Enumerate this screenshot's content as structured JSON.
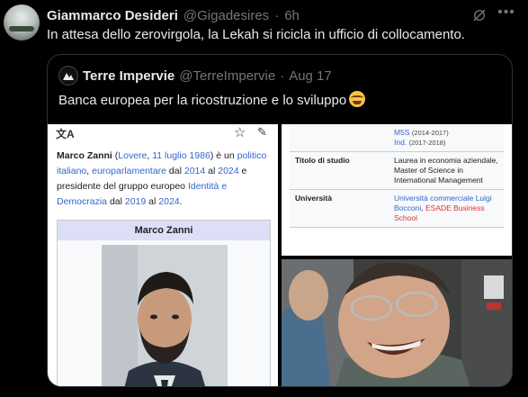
{
  "tweet": {
    "author_name": "Giammarco Desideri",
    "author_handle": "@Gigadesires",
    "separator": "·",
    "time": "6h",
    "text": "In attesa dello zerovirgola, la Lekah si ricicla in ufficio di collocamento.",
    "more_icon": "•••"
  },
  "quote": {
    "author_name": "Terre Impervie",
    "author_handle": "@TerreImpervie",
    "separator": "·",
    "date": "Aug 17",
    "text": "Banca europea per la ricostruzione e lo sviluppo"
  },
  "wiki": {
    "subject": "Marco Zanni",
    "sep1": " (",
    "birthplace": "Lovere",
    "sep2": ", ",
    "birthdate": "11 luglio 1986",
    "sep3": ") è un ",
    "link_politico": "politico italiano",
    "sep4": ", ",
    "link_euro": "europarlamentare",
    "sep5": " dal ",
    "year1": "2014",
    "sep6": " al ",
    "year2": "2024",
    "sep7": " e presidente del gruppo europeo ",
    "group": "Identità e Democrazia",
    "sep8": " dal ",
    "year3": "2019",
    "sep9": " al ",
    "year4": "2024",
    "sep10": ".",
    "infobox_title": "Marco Zanni"
  },
  "table": {
    "party_top": "M5S",
    "party_top_years": "(2014-2017)",
    "party_ind": "Ind.",
    "party_ind_years": "(2017-2018)",
    "education_label": "Titolo di studio",
    "education_value": "Laurea in economia aziendale, Master of Science in International Management",
    "university_label": "Università",
    "university_link1": "Università commerciale Luigi Bocconi",
    "university_sep": ", ",
    "university_link2": "ESADE Business School"
  }
}
